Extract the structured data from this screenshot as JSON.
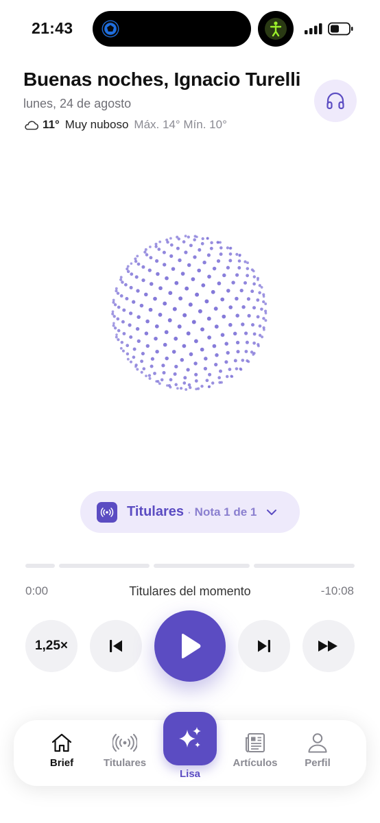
{
  "status_bar": {
    "time": "21:43"
  },
  "header": {
    "greeting": "Buenas noches, Ignacio Turelli",
    "date": "lunes, 24 de agosto",
    "weather": {
      "icon": "cloud-icon",
      "temperature": "11°",
      "condition": "Muy nuboso",
      "range": "Máx. 14° Mín. 10°"
    }
  },
  "now_playing": {
    "pill_title": "Titulares",
    "pill_separator": "·",
    "pill_subtitle": "Nota 1 de 1",
    "track_title": "Titulares del momento",
    "elapsed": "0:00",
    "remaining": "-10:08",
    "progress": 0
  },
  "controls": {
    "speed": "1,25×"
  },
  "tabbar": {
    "items": [
      {
        "label": "Brief",
        "icon": "home-icon",
        "active": true
      },
      {
        "label": "Titulares",
        "icon": "broadcast-icon",
        "active": false
      },
      {
        "label": "Lisa",
        "icon": "sparkles-icon",
        "active": false
      },
      {
        "label": "Artículos",
        "icon": "newspaper-icon",
        "active": false
      },
      {
        "label": "Perfil",
        "icon": "person-icon",
        "active": false
      }
    ]
  },
  "colors": {
    "accent": "#5b4cc2",
    "accent_light": "#eeeafb",
    "dots": "#7b6fd6"
  }
}
